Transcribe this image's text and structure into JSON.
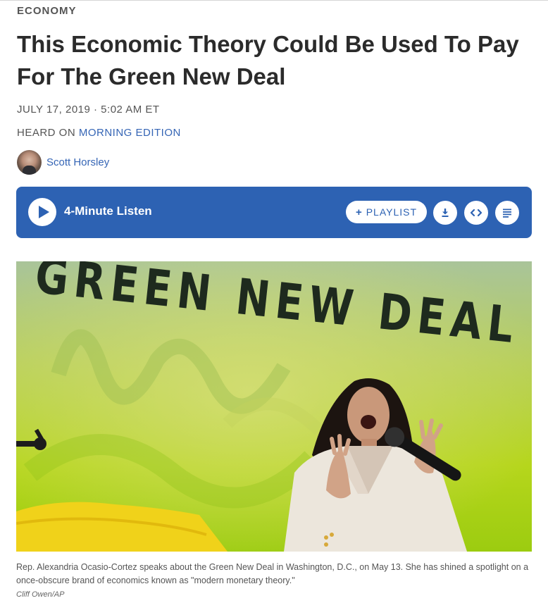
{
  "article": {
    "section": "ECONOMY",
    "headline": "This Economic Theory Could Be Used To Pay For The Green New Deal",
    "dateline": "JULY 17, 2019 · 5:02 AM ET",
    "heard_on_prefix": "HEARD ON ",
    "heard_on_program": "MORNING EDITION",
    "author": "Scott Horsley"
  },
  "player": {
    "listen_label": "4-Minute Listen",
    "playlist_plus": "+",
    "playlist_label": "PLAYLIST",
    "play_icon": "play-icon",
    "download_icon": "download-icon",
    "embed_icon": "embed-icon",
    "transcript_icon": "transcript-icon",
    "accent_color": "#2d62b3"
  },
  "photo": {
    "banner_text": "GREEN NEW DEAL",
    "caption": "Rep. Alexandria Ocasio-Cortez speaks about the Green New Deal in Washington, D.C., on May 13. She has shined a spotlight on a once-obscure brand of economics known as \"modern monetary theory.\"",
    "credit": "Cliff Owen/AP"
  }
}
